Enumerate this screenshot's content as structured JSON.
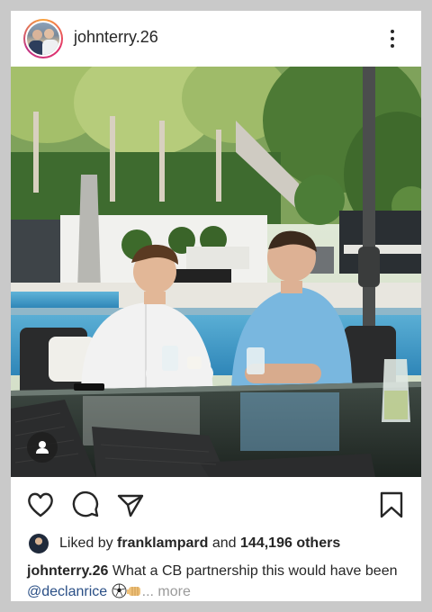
{
  "post": {
    "username": "johnterry.26",
    "liked_by_prefix": "Liked by",
    "liked_by_user": "franklampard",
    "liked_by_and": "and",
    "likes_count": "144,196 others",
    "caption_user": "johnterry.26",
    "caption_text": "What a CB partnership this would have been",
    "caption_mention": "@declanrice",
    "caption_more": "... more"
  },
  "icons": {
    "options": "more-vertical-icon",
    "like": "heart-icon",
    "comment": "comment-icon",
    "share": "send-icon",
    "save": "bookmark-icon",
    "tags": "user-tag-icon"
  },
  "colors": {
    "mention": "#2a4f86",
    "muted": "#9a9a9a",
    "text": "#262626"
  }
}
